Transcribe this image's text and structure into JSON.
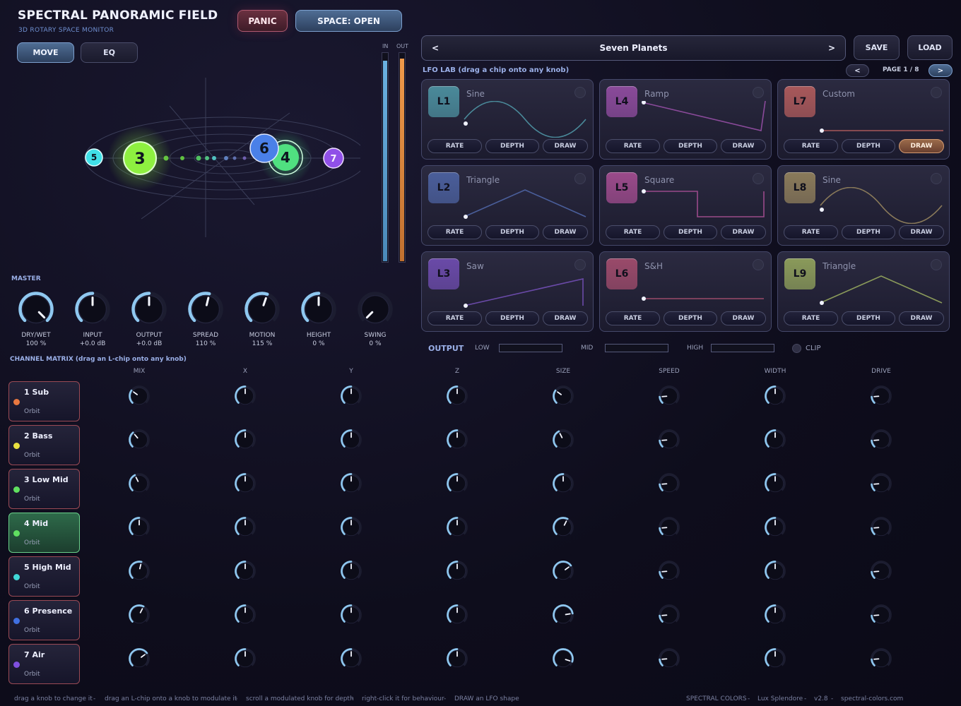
{
  "app": {
    "title": "SPECTRAL PANORAMIC FIELD",
    "subtitle": "3D ROTARY SPACE MONITOR"
  },
  "top_buttons": {
    "panic": "PANIC",
    "space": "SPACE:  OPEN"
  },
  "mode_tabs": [
    {
      "label": "MOVE",
      "active": true
    },
    {
      "label": "EQ",
      "active": false
    }
  ],
  "meters": {
    "in_label": "IN",
    "out_label": "OUT",
    "in_level": 0.96,
    "out_level": 0.97,
    "in_color": "#5aa0d0",
    "out_color": "#e08a3a"
  },
  "preset": {
    "name": "Seven Planets",
    "prev": "<",
    "next": ">",
    "save": "SAVE",
    "load": "LOAD"
  },
  "lfo_lab": {
    "title": "LFO LAB  (drag a chip onto any knob)",
    "page": "PAGE 1 / 8",
    "page_prev": "<",
    "page_next": ">"
  },
  "lfos": [
    {
      "id": "L1",
      "shape": "Sine",
      "color": "#4a8a9a"
    },
    {
      "id": "L4",
      "shape": "Ramp",
      "color": "#8a4a9a"
    },
    {
      "id": "L7",
      "shape": "Custom",
      "color": "#a8585a"
    },
    {
      "id": "L2",
      "shape": "Triangle",
      "color": "#4a5e9a"
    },
    {
      "id": "L5",
      "shape": "Square",
      "color": "#9a4a8a"
    },
    {
      "id": "L8",
      "shape": "Sine",
      "color": "#8a7a5a"
    },
    {
      "id": "L3",
      "shape": "Saw",
      "color": "#6a4aa8"
    },
    {
      "id": "L6",
      "shape": "S&H",
      "color": "#9a4a6a"
    },
    {
      "id": "L9",
      "shape": "Triangle",
      "color": "#8a9a5a"
    }
  ],
  "lfo_buttons": {
    "rate": "RATE",
    "depth": "DEPTH",
    "draw": "DRAW"
  },
  "master": {
    "title": "MASTER",
    "knobs": [
      {
        "label": "DRY/WET",
        "value": "100 %",
        "pos": 1.0
      },
      {
        "label": "INPUT",
        "value": "+0.0 dB",
        "pos": 0.5
      },
      {
        "label": "OUTPUT",
        "value": "+0.0 dB",
        "pos": 0.5
      },
      {
        "label": "SPREAD",
        "value": "110 %",
        "pos": 0.55
      },
      {
        "label": "MOTION",
        "value": "115 %",
        "pos": 0.57
      },
      {
        "label": "HEIGHT",
        "value": "0 %",
        "pos": 0.5
      },
      {
        "label": "SWING",
        "value": "0 %",
        "pos": 0.0
      }
    ]
  },
  "output": {
    "title": "OUTPUT",
    "low": "LOW",
    "mid": "MID",
    "high": "HIGH",
    "clip": "CLIP"
  },
  "matrix": {
    "title": "CHANNEL MATRIX  (drag an L-chip onto any knob)",
    "columns": [
      "MIX",
      "X",
      "Y",
      "Z",
      "SIZE",
      "SPEED",
      "WIDTH",
      "DRIVE"
    ],
    "channels": [
      {
        "name": "1 Sub",
        "sub": "Orbit",
        "color": "#e87840",
        "knobs": [
          0.3,
          0.5,
          0.5,
          0.5,
          0.3,
          0.15,
          0.5,
          0.15
        ]
      },
      {
        "name": "2 Bass",
        "sub": "Orbit",
        "color": "#e8e040",
        "knobs": [
          0.35,
          0.5,
          0.5,
          0.5,
          0.4,
          0.15,
          0.5,
          0.15
        ]
      },
      {
        "name": "3 Low Mid",
        "sub": "Orbit",
        "color": "#60e060",
        "knobs": [
          0.4,
          0.5,
          0.5,
          0.5,
          0.5,
          0.15,
          0.5,
          0.15
        ]
      },
      {
        "name": "4 Mid",
        "sub": "Orbit",
        "color": "#60e060",
        "knobs": [
          0.5,
          0.5,
          0.5,
          0.5,
          0.6,
          0.15,
          0.5,
          0.15
        ],
        "selected": true
      },
      {
        "name": "5 High Mid",
        "sub": "Orbit",
        "color": "#40d8d8",
        "knobs": [
          0.55,
          0.5,
          0.5,
          0.5,
          0.7,
          0.15,
          0.5,
          0.15
        ]
      },
      {
        "name": "6 Presence",
        "sub": "Orbit",
        "color": "#4070e0",
        "knobs": [
          0.6,
          0.5,
          0.5,
          0.5,
          0.8,
          0.15,
          0.5,
          0.15
        ]
      },
      {
        "name": "7 Air",
        "sub": "Orbit",
        "color": "#8050e0",
        "knobs": [
          0.7,
          0.5,
          0.5,
          0.5,
          0.9,
          0.15,
          0.5,
          0.15
        ]
      }
    ]
  },
  "planets": [
    {
      "n": "5",
      "color": "#40e0e8"
    },
    {
      "n": "3",
      "color": "#8ef040"
    },
    {
      "n": "6",
      "color": "#4a80e8"
    },
    {
      "n": "4",
      "color": "#50e080"
    },
    {
      "n": "7",
      "color": "#9050e8"
    }
  ],
  "footer": {
    "hints": [
      "drag a knob to change it",
      "-",
      "drag an L-chip onto a knob to modulate it",
      "-",
      "scroll a modulated knob for depth",
      "-",
      "right-click it for behaviour",
      "-",
      "DRAW an LFO shape"
    ],
    "brand": [
      "SPECTRAL COLORS",
      "-",
      "Lux Splendore",
      "-",
      "v2.8",
      "-",
      "spectral-colors.com"
    ]
  }
}
